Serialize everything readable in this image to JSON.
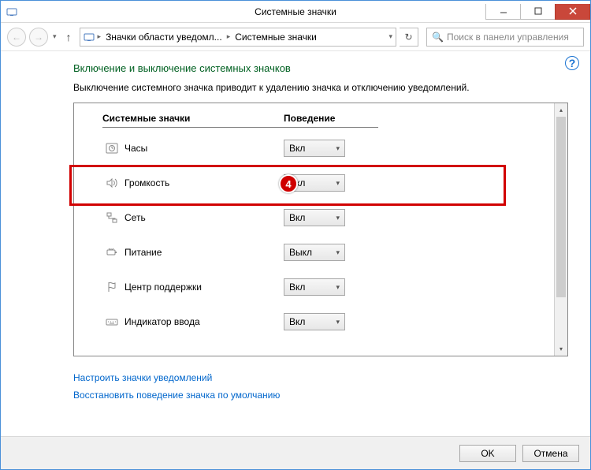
{
  "window": {
    "title": "Системные значки"
  },
  "breadcrumb": {
    "item1": "Значки области уведомл...",
    "item2": "Системные значки"
  },
  "search": {
    "placeholder": "Поиск в панели управления"
  },
  "heading": "Включение и выключение системных значков",
  "description": "Выключение системного значка приводит к удалению значка и отключению уведомлений.",
  "columns": {
    "label": "Системные значки",
    "behavior": "Поведение"
  },
  "options": {
    "on": "Вкл",
    "off": "Выкл"
  },
  "rows": [
    {
      "label": "Часы",
      "value": "Вкл"
    },
    {
      "label": "Громкость",
      "value": "Вкл"
    },
    {
      "label": "Сеть",
      "value": "Вкл"
    },
    {
      "label": "Питание",
      "value": "Выкл"
    },
    {
      "label": "Центр поддержки",
      "value": "Вкл"
    },
    {
      "label": "Индикатор ввода",
      "value": "Вкл"
    }
  ],
  "badge": "4",
  "links": {
    "customize": "Настроить значки уведомлений",
    "restore": "Восстановить поведение значка по умолчанию"
  },
  "footer": {
    "ok": "OK",
    "cancel": "Отмена"
  }
}
